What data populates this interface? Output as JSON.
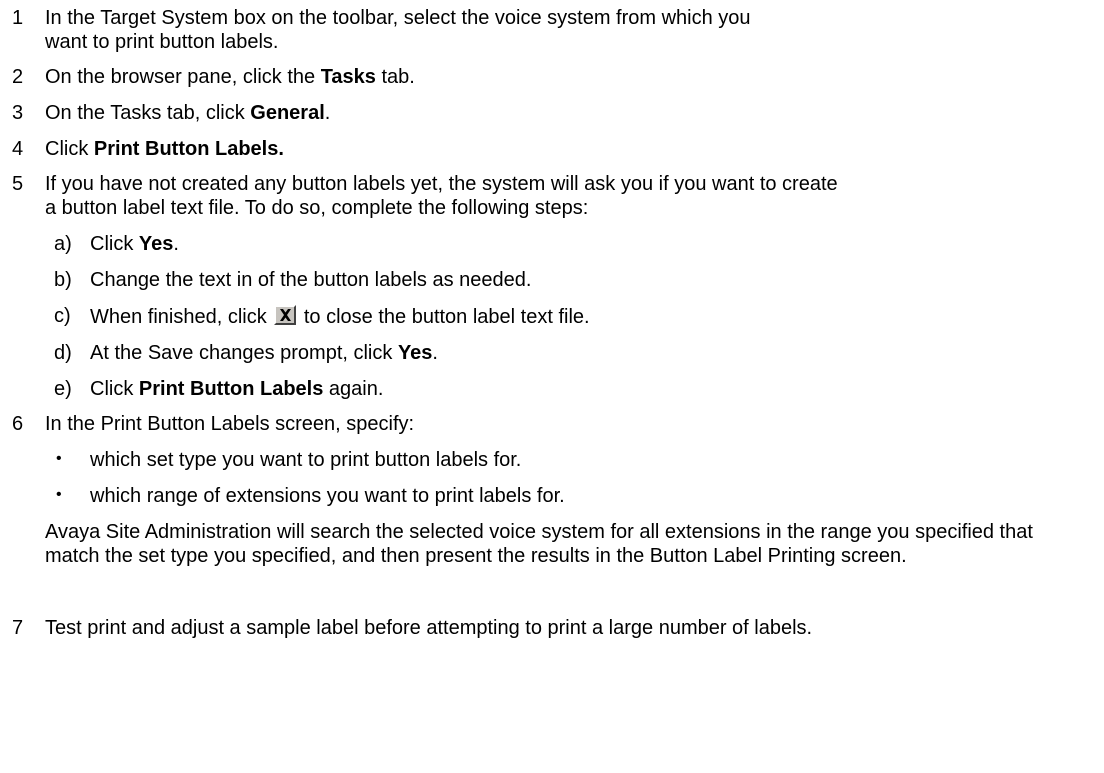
{
  "steps": [
    {
      "num": "1",
      "a": "In the Target System box on the toolbar, select the voice system from which you want to print button labels."
    },
    {
      "num": "2",
      "a": "On the browser pane, click the ",
      "b": "Tasks",
      "c": " tab."
    },
    {
      "num": "3",
      "a": "On the Tasks tab, click ",
      "b": "General",
      "c": "."
    },
    {
      "num": "4",
      "a": "Click ",
      "b": "Print Button Labels."
    },
    {
      "num": "5",
      "a": "If you have not created any button labels yet, the system will ask you if you want to create a button label text file. To do so, complete the following steps:"
    },
    {
      "num": "6",
      "a": "In the Print Button Labels screen, specify:"
    },
    {
      "num": "7",
      "a": "Test print and adjust a sample label before attempting to print a large number of labels."
    }
  ],
  "substeps": [
    {
      "letter": "a)",
      "a": "Click ",
      "b": "Yes",
      "c": "."
    },
    {
      "letter": "b)",
      "a": "Change the text in of the button labels as needed."
    },
    {
      "letter": "c)",
      "a": "When finished, click ",
      "c": " to close the button label text file."
    },
    {
      "letter": "d)",
      "a": "At the Save changes prompt, click ",
      "b": "Yes",
      "c": "."
    },
    {
      "letter": "e)",
      "a": "Click ",
      "b": "Print Button Labels",
      "c": " again."
    }
  ],
  "bullets": [
    "which set type you want to print button labels for.",
    "which range of extensions you want to print labels for."
  ],
  "bullet_symbol": "•",
  "step6_note": "Avaya Site Administration will search the selected voice system for all extensions in the range you specified that match the set type you specified, and then present the results in the Button Label Printing screen.",
  "close_icon": "close-x-icon"
}
